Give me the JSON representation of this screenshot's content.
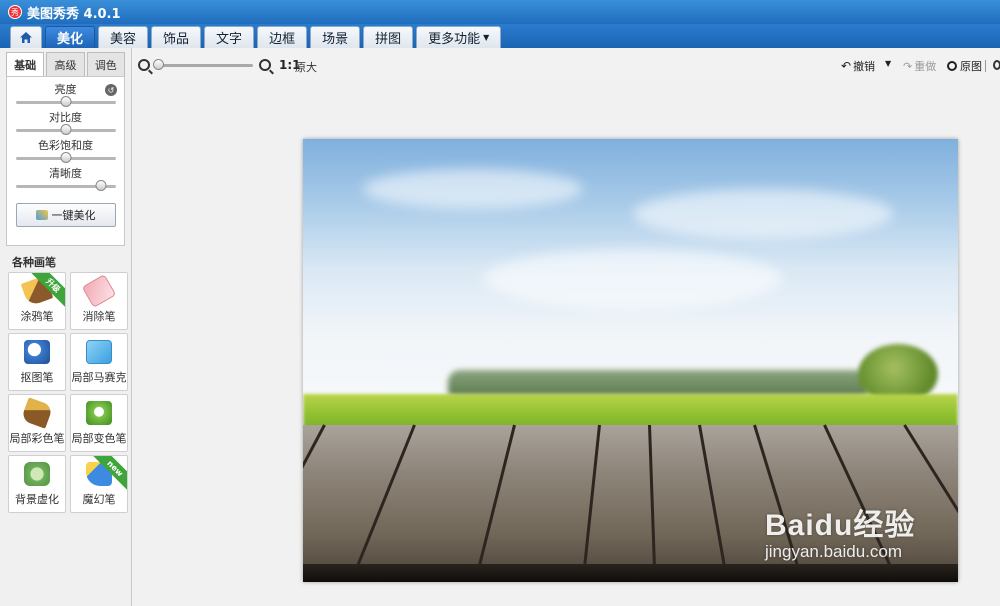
{
  "app": {
    "title": "美图秀秀 4.0.1",
    "logo_char": "秀"
  },
  "tabs": [
    {
      "label": "美化",
      "active": true
    },
    {
      "label": "美容"
    },
    {
      "label": "饰品"
    },
    {
      "label": "文字"
    },
    {
      "label": "边框"
    },
    {
      "label": "场景"
    },
    {
      "label": "拼图"
    },
    {
      "label": "更多功能",
      "dropdown": true
    }
  ],
  "left_panel": {
    "subtabs": [
      {
        "label": "基础",
        "active": true
      },
      {
        "label": "高级"
      },
      {
        "label": "调色"
      }
    ],
    "sliders": [
      {
        "label": "亮度",
        "value": 0.5
      },
      {
        "label": "对比度",
        "value": 0.5
      },
      {
        "label": "色彩饱和度",
        "value": 0.5
      },
      {
        "label": "清晰度",
        "value": 0.85
      }
    ],
    "one_key_button": "一键美化",
    "brushes_title": "各种画笔",
    "tools": [
      {
        "label": "涂鸦笔",
        "icon": "doodle-brush-icon",
        "badge": "升级"
      },
      {
        "label": "消除笔",
        "icon": "eraser-icon"
      },
      {
        "label": "抠图笔",
        "icon": "cutout-pen-icon"
      },
      {
        "label": "局部马赛克",
        "icon": "mosaic-icon"
      },
      {
        "label": "局部彩色笔",
        "icon": "color-brush-icon"
      },
      {
        "label": "局部变色笔",
        "icon": "color-change-icon"
      },
      {
        "label": "背景虚化",
        "icon": "background-blur-icon"
      },
      {
        "label": "魔幻笔",
        "icon": "magic-pen-icon",
        "badge": "new"
      }
    ]
  },
  "toolbar": {
    "zoom_level": 0.0,
    "ratio": "1:1",
    "original_size": "原大",
    "undo": "撤销",
    "redo": "重做",
    "original": "原图"
  },
  "watermark": {
    "logo": "Baidu经验",
    "url": "jingyan.baidu.com"
  }
}
